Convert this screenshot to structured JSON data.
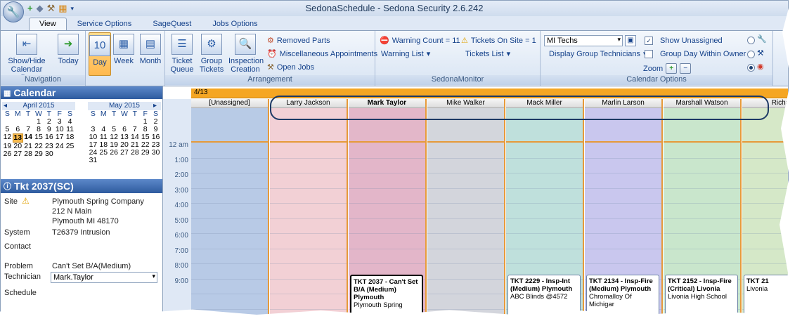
{
  "window": {
    "title": "SedonaSchedule - Sedona Security 2.6.242"
  },
  "tabs": [
    {
      "label": "View",
      "active": true
    },
    {
      "label": "Service Options",
      "active": false
    },
    {
      "label": "SageQuest",
      "active": false
    },
    {
      "label": "Jobs Options",
      "active": false
    }
  ],
  "ribbon": {
    "navigation": {
      "label": "Navigation",
      "show_hide": "Show/Hide Calendar Bar",
      "today": "Today"
    },
    "views": {
      "day": "Day",
      "week": "Week",
      "month": "Month"
    },
    "arrangement": {
      "label": "Arrangement",
      "ticket_queue": "Ticket Queue",
      "group_tickets": "Group Tickets",
      "inspection_creation": "Inspection Creation",
      "removed_parts": "Removed Parts",
      "misc_appointments": "Miscellaneous Appointments",
      "open_jobs": "Open Jobs"
    },
    "monitor": {
      "label": "SedonaMonitor",
      "warning_count": "Warning Count = 11",
      "warning_list": "Warning List",
      "tickets_on_site": "Tickets On Site = 1",
      "tickets_list": "Tickets List"
    },
    "calendar_options": {
      "label": "Calendar Options",
      "group_select": "MI Techs",
      "display_group": "Display Group Technicians",
      "show_unassigned": "Show Unassigned",
      "group_day": "Group Day Within Owner",
      "zoom": "Zoom",
      "zoom_in": "+",
      "zoom_out": "−"
    }
  },
  "calendar": {
    "title": "Calendar",
    "april": {
      "title": "April 2015",
      "dow": [
        "S",
        "M",
        "T",
        "W",
        "T",
        "F",
        "S"
      ],
      "weeks": [
        [
          "",
          "",
          "",
          "1",
          "2",
          "3",
          "4"
        ],
        [
          "5",
          "6",
          "7",
          "8",
          "9",
          "10",
          "11"
        ],
        [
          "12",
          "13",
          "14",
          "15",
          "16",
          "17",
          "18"
        ],
        [
          "19",
          "20",
          "21",
          "22",
          "23",
          "24",
          "25"
        ],
        [
          "26",
          "27",
          "28",
          "29",
          "30",
          "",
          ""
        ]
      ]
    },
    "may": {
      "title": "May 2015",
      "dow": [
        "S",
        "M",
        "T",
        "W",
        "T",
        "F",
        "S"
      ],
      "weeks": [
        [
          "",
          "",
          "",
          "",
          "",
          "1",
          "2"
        ],
        [
          "3",
          "4",
          "5",
          "6",
          "7",
          "8",
          "9"
        ],
        [
          "10",
          "11",
          "12",
          "13",
          "14",
          "15",
          "16"
        ],
        [
          "17",
          "18",
          "19",
          "20",
          "21",
          "22",
          "23"
        ],
        [
          "24",
          "25",
          "26",
          "27",
          "28",
          "29",
          "30"
        ],
        [
          "31",
          "",
          "",
          "",
          "",
          "",
          ""
        ]
      ]
    }
  },
  "ticket": {
    "title": "Tkt 2037(SC)",
    "site_label": "Site",
    "site_name": "Plymouth Spring Company",
    "site_address": "212 N Main",
    "site_city": "Plymouth MI 48170",
    "system_label": "System",
    "system_value": "T26379 Intrusion",
    "contact_label": "Contact",
    "problem_label": "Problem",
    "problem_value": "Can't Set B/A(Medium)",
    "technician_label": "Technician",
    "technician_value": "Mark.Taylor",
    "schedule_label": "Schedule"
  },
  "schedule": {
    "date": "4/13",
    "hours": [
      "12 am",
      "1:00",
      "2:00",
      "3:00",
      "4:00",
      "5:00",
      "6:00",
      "7:00",
      "8:00",
      "9:00"
    ],
    "columns": [
      {
        "name": "[Unassigned]",
        "color": "#b8cbe6",
        "bold": false
      },
      {
        "name": "Larry Jackson",
        "color": "#f2d0d6",
        "bold": false
      },
      {
        "name": "Mark Taylor",
        "color": "#e3b7c9",
        "bold": true
      },
      {
        "name": "Mike Walker",
        "color": "#d3d6dc",
        "bold": false
      },
      {
        "name": "Mack Miller",
        "color": "#bfe0dc",
        "bold": false
      },
      {
        "name": "Marlin Larson",
        "color": "#c9c7ee",
        "bold": false
      },
      {
        "name": "Marshall Watson",
        "color": "#c9e6cc",
        "bold": false
      },
      {
        "name": "Richa",
        "color": "#d6e8c8",
        "bold": false
      }
    ],
    "appointments": [
      {
        "col": 2,
        "title": "TKT 2037 - Can't Set B/A (Medium) Plymouth",
        "site": "Plymouth Spring",
        "selected": true
      },
      {
        "col": 4,
        "title": "TKT 2229 - Insp-Int (Medium) Plymouth",
        "site": "ABC Blinds @4572",
        "selected": false
      },
      {
        "col": 5,
        "title": "TKT 2134 - Insp-Fire (Medium) Plymouth",
        "site": "Chromalloy Of Michigar",
        "selected": false
      },
      {
        "col": 6,
        "title": "TKT 2152 - Insp-Fire (Critical) Livonia",
        "site": "Livonia High School",
        "selected": false
      },
      {
        "col": 7,
        "title": "TKT 21",
        "site": "Livonia",
        "selected": false
      }
    ]
  }
}
